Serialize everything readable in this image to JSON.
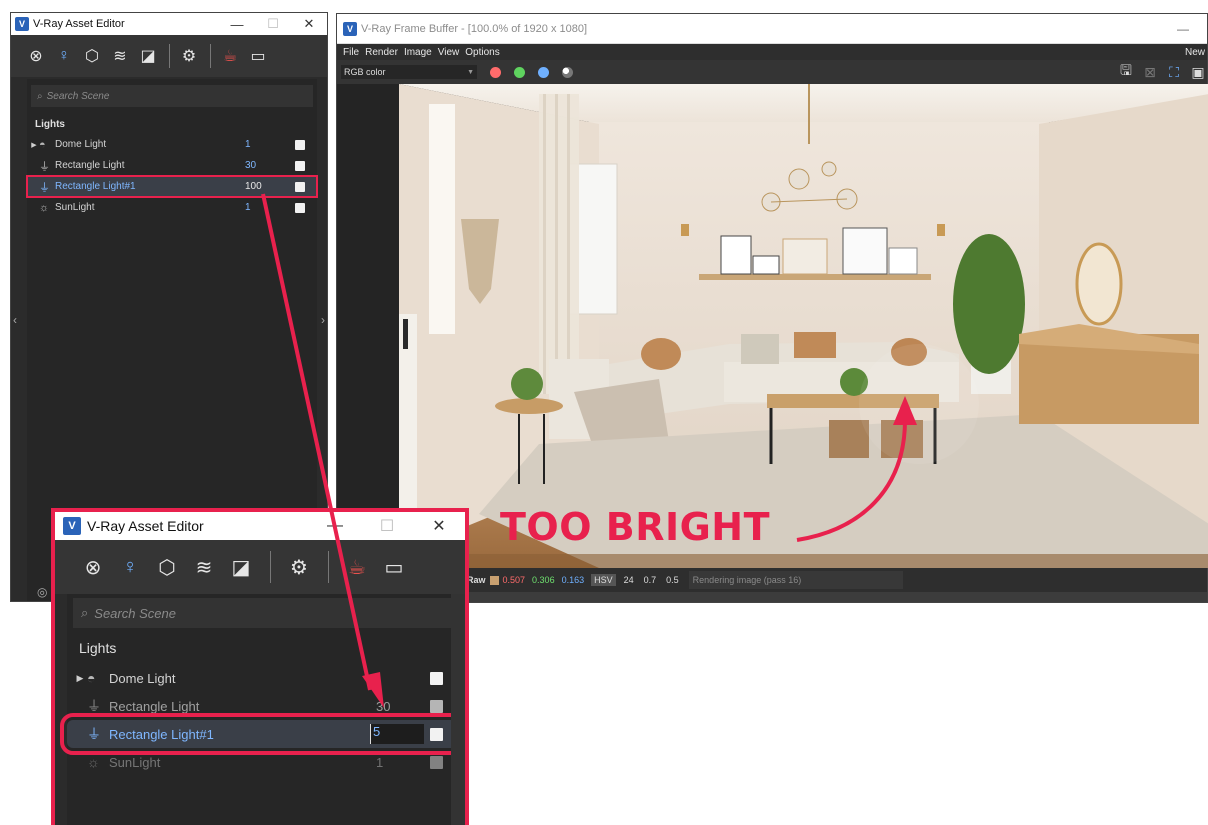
{
  "asset_editor": {
    "title": "V-Ray Asset Editor",
    "minimize": "—",
    "maximize": "☐",
    "close": "✕",
    "search_placeholder": "Search Scene",
    "category": "Lights",
    "lights": [
      {
        "name": "Dome Light",
        "value": "1"
      },
      {
        "name": "Rectangle Light",
        "value": "30"
      },
      {
        "name": "Rectangle Light#1",
        "value": "100"
      },
      {
        "name": "SunLight",
        "value": "1"
      }
    ]
  },
  "asset_editor_zoom": {
    "title": "V-Ray Asset Editor",
    "minimize": "—",
    "maximize": "☐",
    "close": "✕",
    "search_placeholder": "Search Scene",
    "category": "Lights",
    "lights": [
      {
        "name": "Dome Light",
        "value": ""
      },
      {
        "name": "Rectangle Light",
        "value": "30"
      },
      {
        "name": "Rectangle Light#1",
        "value": "5"
      },
      {
        "name": "SunLight",
        "value": "1"
      }
    ]
  },
  "frame_buffer": {
    "title": "V-Ray Frame Buffer - [100.0% of 1920 x 1080]",
    "menu": [
      "File",
      "Render",
      "Image",
      "View",
      "Options"
    ],
    "menu_right": "New",
    "channel": "RGB color",
    "status": {
      "mode": "Raw",
      "r": "0.507",
      "g": "0.306",
      "b": "0.163",
      "color_space": "HSV",
      "v1": "24",
      "v2": "0.7",
      "v3": "0.5",
      "message": "Rendering image (pass 16)"
    }
  },
  "annotation": "TOO BRIGHT",
  "colors": {
    "accent_red": "#e8214d",
    "value_blue": "#7fb7ff",
    "vray_blue": "#2a63b8"
  }
}
